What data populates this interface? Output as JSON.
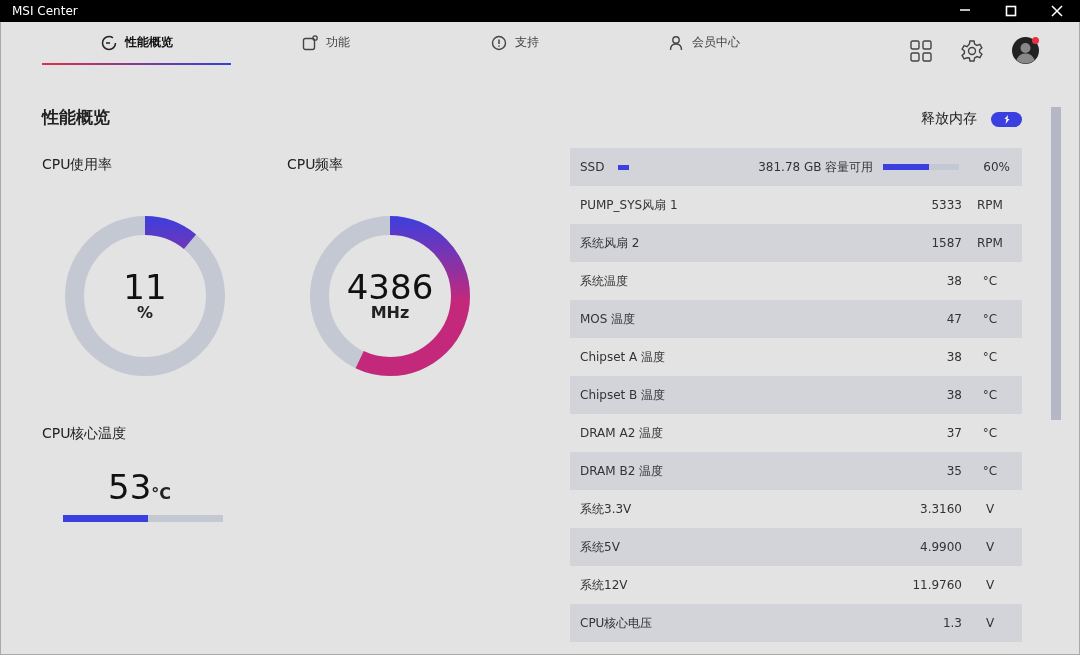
{
  "window": {
    "title": "MSI Center"
  },
  "tabs": [
    {
      "label": "性能概览",
      "selected": true
    },
    {
      "label": "功能",
      "selected": false
    },
    {
      "label": "支持",
      "selected": false
    },
    {
      "label": "会员中心",
      "selected": false
    }
  ],
  "header_actions": {
    "avatar_notification": true
  },
  "page_title": "性能概览",
  "cpu_usage": {
    "label": "CPU使用率",
    "value": "11",
    "unit": "%",
    "level": 0.11
  },
  "cpu_frequency": {
    "label": "CPU频率",
    "value": "4386",
    "unit": "MHz",
    "level": 0.57
  },
  "cpu_temperature": {
    "label": "CPU核心温度",
    "value": "53",
    "unit": "°C",
    "level": 0.53
  },
  "release_memory": {
    "label": "释放内存"
  },
  "sensors": [
    {
      "kind": "storage",
      "name": "SSD",
      "detail": "381.78 GB 容量可用",
      "level": 0.6,
      "value": "60%"
    },
    {
      "kind": "sensor",
      "name": "PUMP_SYS风扇 1",
      "value": "5333",
      "unit": "RPM"
    },
    {
      "kind": "sensor",
      "name": "系统风扇 2",
      "value": "1587",
      "unit": "RPM"
    },
    {
      "kind": "sensor",
      "name": "系统温度",
      "value": "38",
      "unit": "°C"
    },
    {
      "kind": "sensor",
      "name": "MOS 温度",
      "value": "47",
      "unit": "°C"
    },
    {
      "kind": "sensor",
      "name": "Chipset A 温度",
      "value": "38",
      "unit": "°C"
    },
    {
      "kind": "sensor",
      "name": "Chipset B 温度",
      "value": "38",
      "unit": "°C"
    },
    {
      "kind": "sensor",
      "name": "DRAM A2 温度",
      "value": "37",
      "unit": "°C"
    },
    {
      "kind": "sensor",
      "name": "DRAM B2 温度",
      "value": "35",
      "unit": "°C"
    },
    {
      "kind": "sensor",
      "name": "系统3.3V",
      "value": "3.3160",
      "unit": "V"
    },
    {
      "kind": "sensor",
      "name": "系统5V",
      "value": "4.9900",
      "unit": "V"
    },
    {
      "kind": "sensor",
      "name": "系统12V",
      "value": "11.9760",
      "unit": "V"
    },
    {
      "kind": "sensor",
      "name": "CPU核心电压",
      "value": "1.3",
      "unit": "V"
    }
  ]
}
